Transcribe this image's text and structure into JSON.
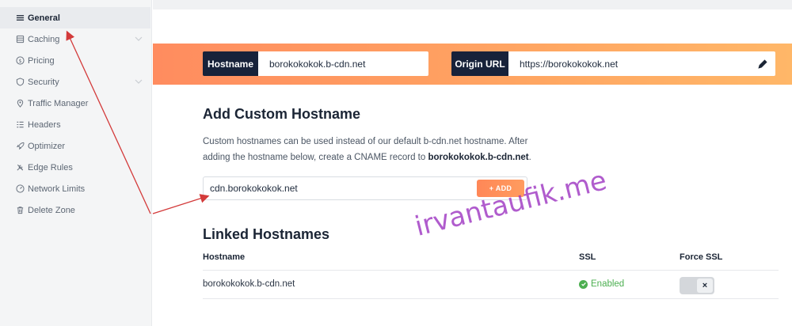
{
  "sidebar": {
    "items": [
      {
        "label": "General",
        "icon": "list-icon"
      },
      {
        "label": "Caching",
        "icon": "database-icon"
      },
      {
        "label": "Pricing",
        "icon": "dollar-icon"
      },
      {
        "label": "Security",
        "icon": "shield-icon"
      },
      {
        "label": "Traffic Manager",
        "icon": "location-pin-icon"
      },
      {
        "label": "Headers",
        "icon": "headers-icon"
      },
      {
        "label": "Optimizer",
        "icon": "rocket-icon"
      },
      {
        "label": "Edge Rules",
        "icon": "tools-icon"
      },
      {
        "label": "Network Limits",
        "icon": "gauge-icon"
      },
      {
        "label": "Delete Zone",
        "icon": "trash-icon"
      }
    ]
  },
  "banner": {
    "hostname_label": "Hostname",
    "hostname_value": "borokokokok.b-cdn.net",
    "origin_label": "Origin URL",
    "origin_value": "https://borokokokok.net"
  },
  "custom_hostname": {
    "title": "Add Custom Hostname",
    "description_pre": "Custom hostnames can be used instead of our default b-cdn.net hostname. After adding the hostname below, create a CNAME record to ",
    "description_bold": "borokokokok.b-cdn.net",
    "description_post": ".",
    "input_value": "cdn.borokokokok.net",
    "add_button": "+ ADD"
  },
  "linked": {
    "title": "Linked Hostnames",
    "columns": [
      "Hostname",
      "SSL",
      "Force SSL"
    ],
    "rows": [
      {
        "hostname": "borokokokok.b-cdn.net",
        "ssl": "Enabled",
        "force_ssl": "×"
      }
    ]
  },
  "watermark": "irvantaufik.me",
  "colors": {
    "accent_orange": "#ff8c5f",
    "dark_navy": "#17223a",
    "ssl_green": "#4caf50",
    "annotation_red": "#d33a3a",
    "watermark_purple": "#9b2fc0"
  }
}
